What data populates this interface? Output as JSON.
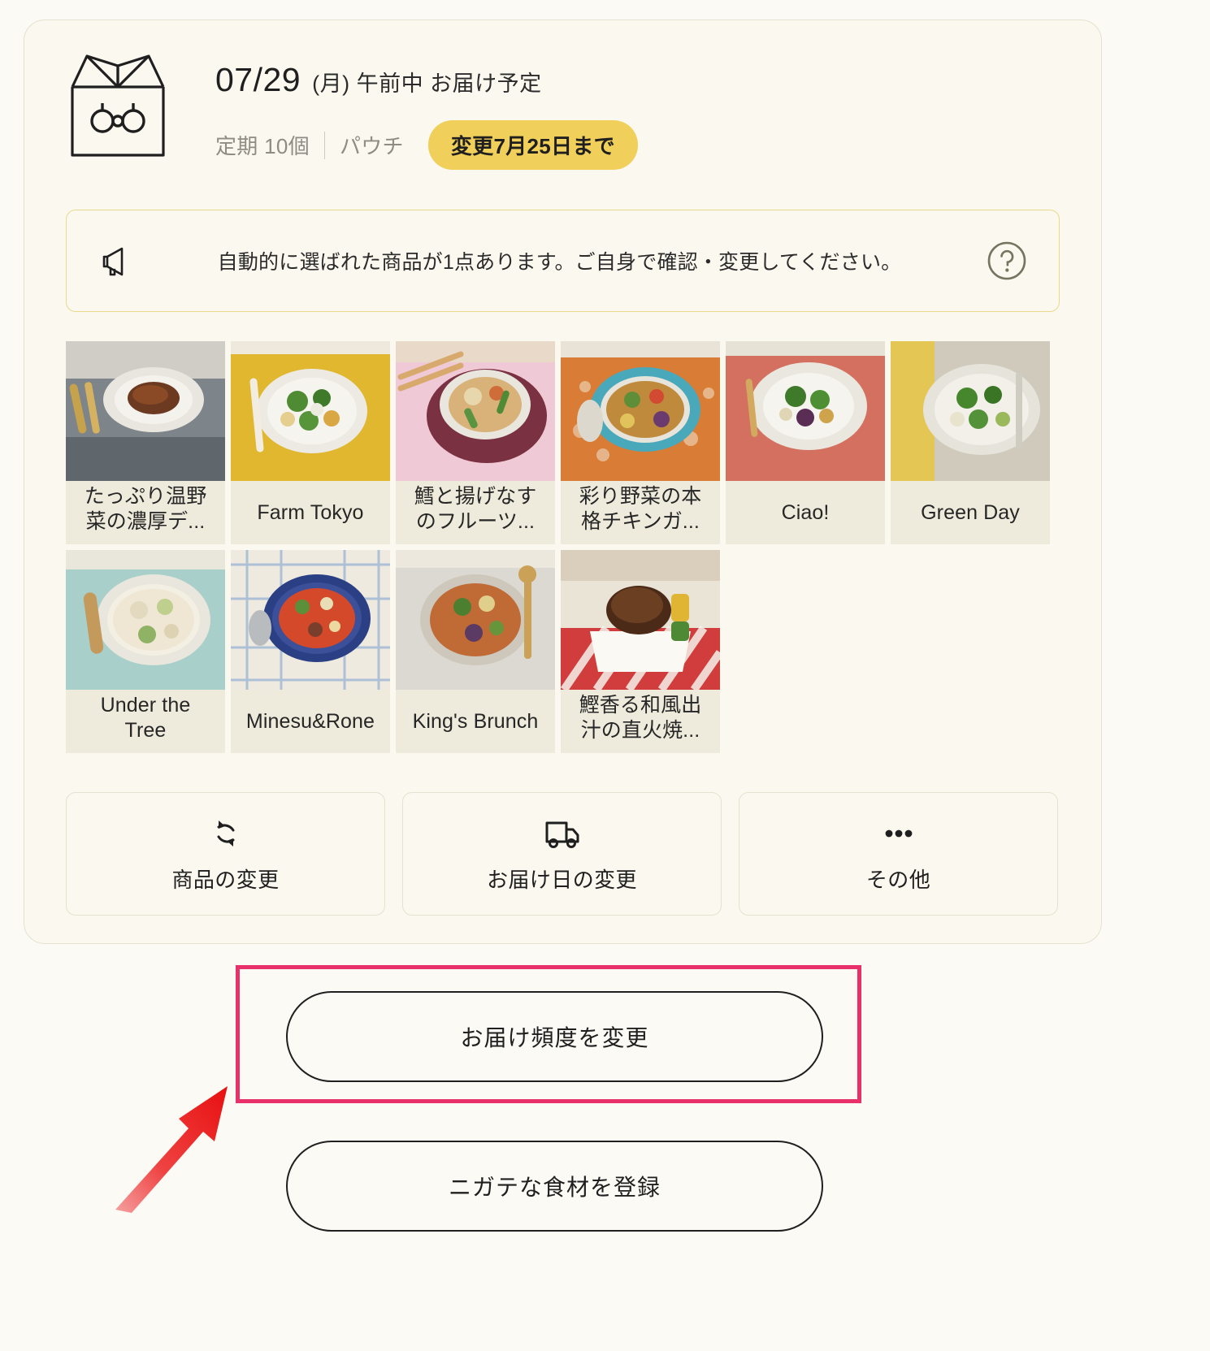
{
  "delivery": {
    "icon": "box-icon",
    "date": "07/29",
    "date_suffix": "(月) 午前中 お届け予定",
    "plan_count": "定期 10個",
    "package_type": "パウチ",
    "deadline_badge": "変更7月25日まで",
    "badge_color": "#f0cf5b"
  },
  "notice": {
    "icon": "megaphone-icon",
    "text": "自動的に選ばれた商品が1点あります。ご自身で確認・変更してください。",
    "help_icon": "help-circle-icon",
    "border_color": "#e9d98e"
  },
  "products": [
    {
      "label": "たっぷり温野菜の濃厚デ...",
      "lines": [
        "たっぷり温野",
        "菜の濃厚デ..."
      ],
      "img": "hamburg-steak"
    },
    {
      "label": "Farm Tokyo",
      "lines": [
        "Farm Tokyo"
      ],
      "img": "green-vegetable-bowl"
    },
    {
      "label": "鱈と揚げなすのフルーツ...",
      "lines": [
        "鱈と揚げなす",
        "のフルーツ..."
      ],
      "img": "cod-eggplant-bowl"
    },
    {
      "label": "彩り野菜の本格チキンガ...",
      "lines": [
        "彩り野菜の本",
        "格チキンガ..."
      ],
      "img": "chicken-curry-bowl"
    },
    {
      "label": "Ciao!",
      "lines": [
        "Ciao!"
      ],
      "img": "broccoli-plate"
    },
    {
      "label": "Green Day",
      "lines": [
        "Green Day"
      ],
      "img": "green-salad-plate"
    },
    {
      "label": "Under the Tree",
      "lines": [
        "Under the",
        "Tree"
      ],
      "img": "cream-stew-bowl"
    },
    {
      "label": "Minesu&Rone",
      "lines": [
        "Minesu&Rone"
      ],
      "img": "minestrone-bowl"
    },
    {
      "label": "King's Brunch",
      "lines": [
        "King's Brunch"
      ],
      "img": "curry-soup-bowl"
    },
    {
      "label": "鰹香る和風出汁の直火焼...",
      "lines": [
        "鰹香る和風出",
        "汁の直火焼..."
      ],
      "img": "grilled-hamburg"
    }
  ],
  "actions": [
    {
      "icon": "refresh-icon",
      "label": "商品の変更"
    },
    {
      "icon": "truck-icon",
      "label": "お届け日の変更"
    },
    {
      "icon": "ellipsis-icon",
      "label": "その他"
    }
  ],
  "bottom_buttons": [
    {
      "label": "お届け頻度を変更",
      "highlighted": true
    },
    {
      "label": "ニガテな食材を登録",
      "highlighted": false
    }
  ],
  "annotation": {
    "highlight_color": "#e8306b",
    "arrow_color": "#ee2222",
    "arrow_name": "pointer-arrow"
  }
}
